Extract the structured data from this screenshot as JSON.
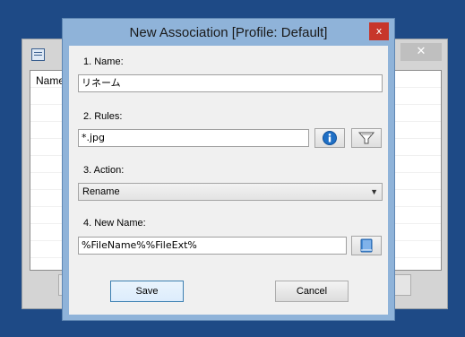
{
  "background_window": {
    "list_header": "Name",
    "close_glyph": "✕"
  },
  "dialog": {
    "title": "New Association [Profile: Default]",
    "close_glyph": "x",
    "name": {
      "label": "1. Name:",
      "value": "リネーム"
    },
    "rules": {
      "label": "2. Rules:",
      "value": "*.jpg",
      "info_icon": "info-icon",
      "filter_icon": "filter-icon"
    },
    "action": {
      "label": "3. Action:",
      "selected": "Rename"
    },
    "new_name": {
      "label": "4. New Name:",
      "value": "%FileName%%FileExt%",
      "book_icon": "book-icon"
    },
    "save_label": "Save",
    "cancel_label": "Cancel"
  },
  "colors": {
    "desktop": "#1e4a86",
    "dialog_frame": "#8fb3d9",
    "close_button": "#c7362b",
    "info_icon": "#1f6fc5"
  }
}
